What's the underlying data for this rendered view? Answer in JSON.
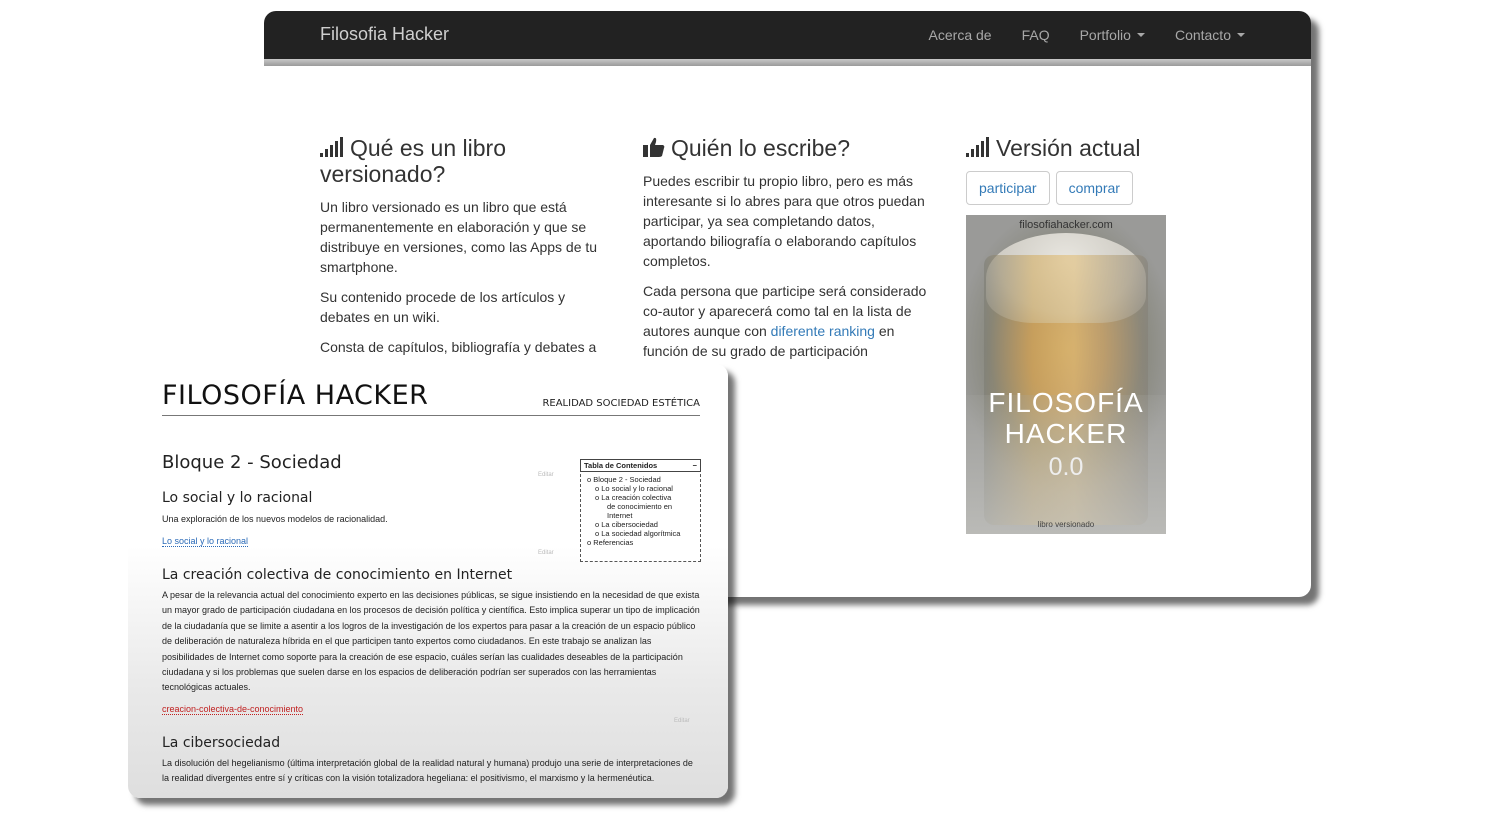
{
  "site": {
    "brand": "Filosofia Hacker",
    "nav": [
      {
        "label": "Acerca de",
        "dropdown": false
      },
      {
        "label": "FAQ",
        "dropdown": false
      },
      {
        "label": "Portfolio",
        "dropdown": true
      },
      {
        "label": "Contacto",
        "dropdown": true
      }
    ],
    "col1": {
      "icon": "signal-bars-icon",
      "heading": "Qué es un libro versionado?",
      "p1": "Un libro versionado es un libro que está permanentemente en elaboración y que se distribuye en versiones, como las Apps de tu smartphone.",
      "p2": "Su contenido procede de los artículos y debates en un wiki.",
      "p3": "Consta de capítulos, bibliografía y debates a"
    },
    "col2": {
      "icon": "thumbs-up-icon",
      "heading": "Quién lo escribe?",
      "p1": "Puedes escribir tu propio libro, pero es más interesante si lo abres para que otros puedan participar, ya sea completando datos, aportando biliografía o elaborando capítulos completos.",
      "p2_before": "Cada persona que participe será considerado co-autor y aparecerá como tal en la lista de autores aunque con ",
      "p2_link": "diferente ranking",
      "p2_after": " en función de su grado de participación"
    },
    "col3": {
      "icon": "signal-bars-icon",
      "heading": "Versión actual",
      "buttons": {
        "participar": "participar",
        "comprar": "comprar"
      },
      "cover": {
        "site": "filosofiahacker.com",
        "title_line1": "FILOSOFÍA",
        "title_line2": "HACKER",
        "version": "0.0",
        "subtitle": "libro versionado"
      }
    }
  },
  "wiki": {
    "title": "FILOSOFÍA HACKER",
    "tagline": "REALIDAD SOCIEDAD ESTÉTICA",
    "edit_label": "Editar",
    "h1": "Bloque 2 - Sociedad",
    "s1": {
      "heading": "Lo social y lo racional",
      "text": "Una exploración de los nuevos modelos de racionalidad.",
      "link": "Lo social y lo racional"
    },
    "s2": {
      "heading": "La creación colectiva de conocimiento en Internet",
      "text": "A pesar de la relevancia actual del conocimiento experto en las decisiones públicas, se sigue insistiendo en la necesidad de que exista un mayor grado de participación ciudadana en los procesos de decisión política y científica. Esto implica superar un tipo de implicación de la ciudadanía que se limite a asentir a los logros de la investigación de los expertos para pasar a la creación de un espacio público de deliberación de naturaleza híbrida en el que participen tanto expertos como ciudadanos. En este trabajo se analizan las posibilidades de Internet como soporte para la creación de ese espacio, cuáles serían las cualidades deseables de la participación ciudadana y si los problemas que suelen darse en los espacios de deliberación podrían ser superados con las herramientas tecnológicas actuales.",
      "link": "creacion-colectiva-de-conocimiento"
    },
    "s3": {
      "heading": "La cibersociedad",
      "text": "La disolución del hegelianismo (última interpretación global de la realidad natural y humana) produjo una serie de interpretaciones de la realidad divergentes entre sí y críticas con la visión totalizadora hegeliana: el positivismo, el marxismo y la hermenéutica."
    },
    "toc": {
      "title": "Tabla de Contenidos",
      "toggle": "−",
      "items": {
        "bloque": "Bloque 2 - Sociedad",
        "social": "Lo social y lo racional",
        "creacion_1": "La creación colectiva",
        "creacion_2": "de conocimiento en",
        "creacion_3": "Internet",
        "ciber": "La cibersociedad",
        "algoritmica": "La sociedad algorítmica",
        "referencias": "Referencias"
      }
    }
  }
}
